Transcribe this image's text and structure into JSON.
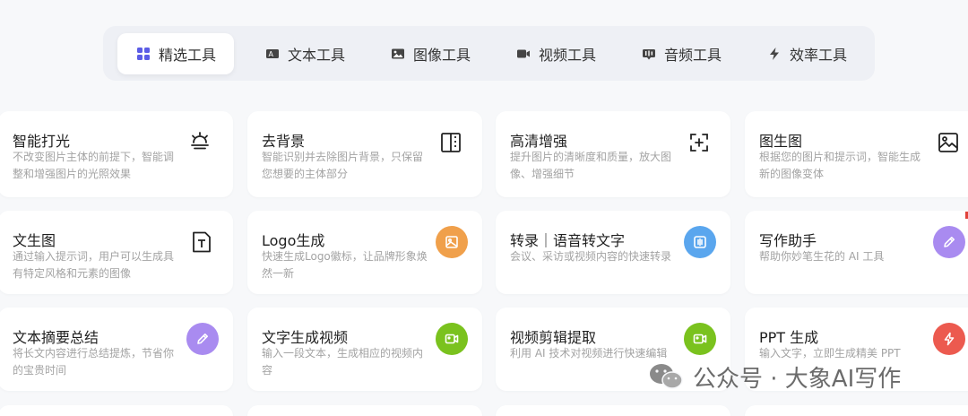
{
  "tabs": [
    {
      "label": "精选工具",
      "icon": "grid-icon",
      "active": true
    },
    {
      "label": "文本工具",
      "icon": "text-tool-icon",
      "active": false
    },
    {
      "label": "图像工具",
      "icon": "image-icon",
      "active": false
    },
    {
      "label": "视频工具",
      "icon": "video-icon",
      "active": false
    },
    {
      "label": "音频工具",
      "icon": "audio-icon",
      "active": false
    },
    {
      "label": "效率工具",
      "icon": "lightning-icon",
      "active": false
    }
  ],
  "cards": [
    {
      "title": "智能打光",
      "desc": "不改变图片主体的前提下，智能调整和增强图片的光照效果",
      "icon": "sunrise-icon"
    },
    {
      "title": "去背景",
      "desc": "智能识别并去除图片背景，只保留您想要的主体部分",
      "icon": "split-frame-icon"
    },
    {
      "title": "高清增强",
      "desc": "提升图片的清晰度和质量，放大图像、增强细节",
      "icon": "focus-plus-icon"
    },
    {
      "title": "图生图",
      "desc": "根据您的图片和提示词，智能生成新的图像变体",
      "icon": "image-icon"
    },
    {
      "title": "文生图",
      "desc": "通过输入提示词，用户可以生成具有特定风格和元素的图像",
      "icon": "text-doc-icon"
    },
    {
      "title": "Logo生成",
      "desc": "快速生成Logo徽标，让品牌形象焕然一新",
      "icon": "image-badge-icon",
      "color": "#f0a04b"
    },
    {
      "title": "转录｜语音转文字",
      "desc": "会议、采访或视频内容的快速转录",
      "icon": "waveform-badge-icon",
      "color": "#5aa6ee"
    },
    {
      "title": "写作助手",
      "desc": "帮助你妙笔生花的 AI 工具",
      "icon": "pen-badge-icon",
      "color": "#a98bf0"
    },
    {
      "title": "文本摘要总结",
      "desc": "将长文内容进行总结提炼，节省你的宝贵时间",
      "icon": "pen-badge-icon",
      "color": "#a98bf0"
    },
    {
      "title": "文字生成视频",
      "desc": "输入一段文本，生成相应的视频内容",
      "icon": "video-badge-icon",
      "color": "#7ac21e"
    },
    {
      "title": "视频剪辑提取",
      "desc": "利用 AI 技术对视频进行快速编辑",
      "icon": "video-badge-icon",
      "color": "#7ac21e"
    },
    {
      "title": "PPT 生成",
      "desc": "输入文字，立即生成精美 PPT",
      "icon": "lightning-badge-icon",
      "color": "#ec5a4f"
    }
  ],
  "watermark": {
    "text": "公众号 · 大象AI写作",
    "icon": "wechat-icon"
  }
}
